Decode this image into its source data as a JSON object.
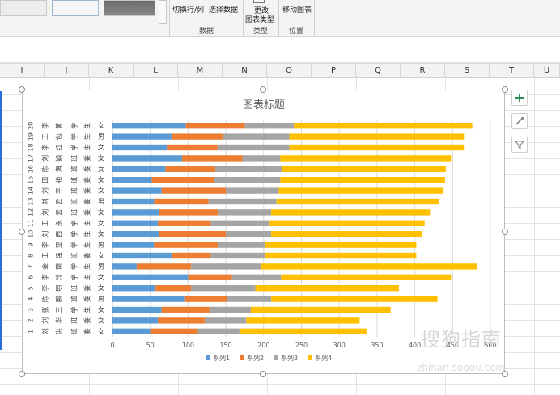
{
  "ribbon": {
    "switch_row_col": "切换行/列",
    "select_data": "选择数据",
    "change_chart_type_line1": "更改",
    "change_chart_type_line2": "图表类型",
    "move_chart": "移动图表",
    "group_data": "数据",
    "group_type": "类型",
    "group_location": "位置"
  },
  "columns": [
    "I",
    "J",
    "K",
    "L",
    "M",
    "N",
    "O",
    "P",
    "Q",
    "R",
    "S",
    "T",
    "U"
  ],
  "chart_data": {
    "type": "bar",
    "orientation": "horizontal",
    "stacked": true,
    "title": "图表标题",
    "xlim": [
      0,
      500
    ],
    "xticks": [
      "0",
      "50",
      "100",
      "150",
      "200",
      "250",
      "300",
      "350",
      "400",
      "450",
      "500"
    ],
    "categories": [
      [
        "1",
        "刘",
        "洪",
        "班",
        "委",
        "女"
      ],
      [
        "2",
        "刘",
        "华",
        "班",
        "委",
        "女"
      ],
      [
        "3",
        "张",
        "三",
        "学",
        "生",
        "女"
      ],
      [
        "4",
        "陈",
        "鹏",
        "班",
        "委",
        "男"
      ],
      [
        "5",
        "李",
        "明",
        "班",
        "委",
        "女"
      ],
      [
        "6",
        "李",
        "玲",
        "学",
        "生",
        "女"
      ],
      [
        "7",
        "金",
        "南",
        "学",
        "生",
        "男"
      ],
      [
        "8",
        "王",
        "强",
        "班",
        "委",
        "女"
      ],
      [
        "9",
        "李",
        "亚",
        "学",
        "生",
        "男"
      ],
      [
        "10",
        "刘",
        "西",
        "学",
        "生",
        "女"
      ],
      [
        "11",
        "王",
        "永",
        "学",
        "生",
        "女"
      ],
      [
        "12",
        "刘",
        "云",
        "班",
        "委",
        "女"
      ],
      [
        "13",
        "刘",
        "云",
        "班",
        "委",
        "男"
      ],
      [
        "14",
        "刘",
        "平",
        "班",
        "委",
        "女"
      ],
      [
        "15",
        "田",
        "艳",
        "班",
        "委",
        "女"
      ],
      [
        "16",
        "陈",
        "海",
        "班",
        "委",
        "女"
      ],
      [
        "17",
        "刘",
        "娟",
        "班",
        "委",
        "女"
      ],
      [
        "18",
        "李",
        "红",
        "学",
        "生",
        "女"
      ],
      [
        "19",
        "王",
        "包",
        "学",
        "生",
        "男"
      ],
      [
        "20",
        "李",
        "黄",
        "学",
        "生",
        "女"
      ]
    ],
    "series": [
      {
        "name": "系列1",
        "color": "#5b9bd5",
        "values": [
          50,
          60,
          65,
          95,
          57,
          100,
          32,
          78,
          55,
          62,
          60,
          62,
          55,
          65,
          52,
          70,
          92,
          72,
          78,
          97
        ]
      },
      {
        "name": "系列2",
        "color": "#ed7d31",
        "values": [
          63,
          62,
          63,
          57,
          47,
          58,
          72,
          52,
          85,
          88,
          70,
          78,
          72,
          85,
          82,
          66,
          80,
          67,
          68,
          78
        ]
      },
      {
        "name": "系列3",
        "color": "#a5a5a5",
        "values": [
          55,
          55,
          55,
          58,
          85,
          65,
          93,
          72,
          62,
          60,
          78,
          70,
          90,
          70,
          88,
          88,
          50,
          95,
          88,
          65
        ]
      },
      {
        "name": "系列4",
        "color": "#ffc000",
        "values": [
          168,
          150,
          185,
          220,
          190,
          225,
          285,
          200,
          200,
          200,
          205,
          210,
          215,
          218,
          218,
          217,
          226,
          231,
          231,
          236
        ]
      }
    ],
    "legend_position": "bottom",
    "gridlines": "vertical"
  },
  "watermark": {
    "line1": "搜狗指南",
    "line2": "zhinan.sogou.com"
  },
  "icons": {
    "add": "plus-icon",
    "style": "brush-icon",
    "filter": "filter-icon"
  }
}
